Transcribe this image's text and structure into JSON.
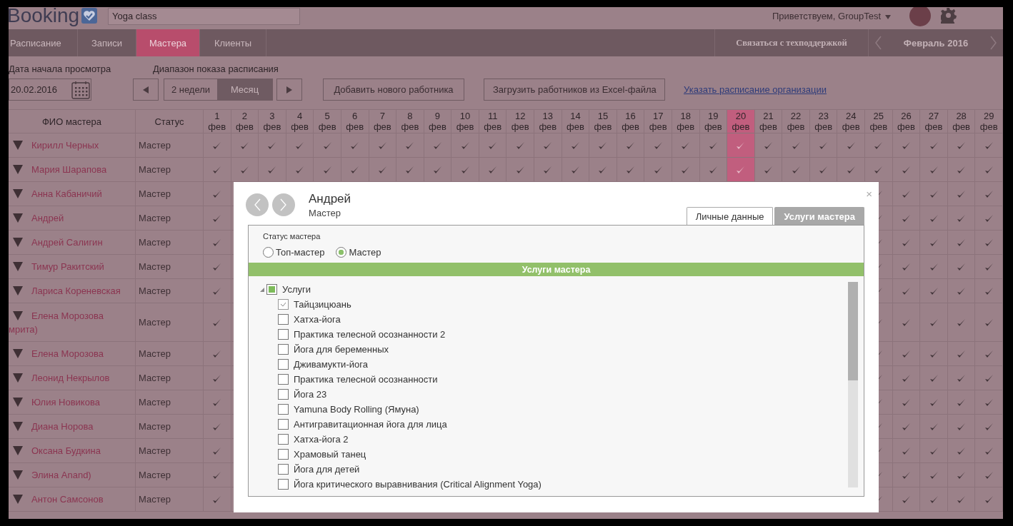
{
  "header": {
    "logo": "Booking",
    "search": {
      "value": "Yoga class"
    },
    "greeting": "Приветствуем, GroupTest"
  },
  "nav": {
    "tabs": [
      {
        "label": "Расписание",
        "selected": false
      },
      {
        "label": "Записи",
        "selected": false
      },
      {
        "label": "Мастера",
        "selected": true
      },
      {
        "label": "Клиенты",
        "selected": false
      }
    ],
    "support": "Связаться с техподдержкой",
    "month": "Февраль 2016"
  },
  "toolbar": {
    "date_label": "Дата начала просмотра",
    "date": {
      "value": "20.02.2016"
    },
    "range_label": "Диапазон показа расписания",
    "range": [
      {
        "label": "2 недели",
        "selected": false
      },
      {
        "label": "Месяц",
        "selected": true
      }
    ],
    "buttons": [
      "Добавить нового работника",
      "Загрузить работников из Excel-файла"
    ],
    "link": "Указать расписание организации"
  },
  "table": {
    "columns": [
      "ФИО мастера",
      "Статус"
    ],
    "days": [
      {
        "number": "1",
        "month": "фев",
        "today": false
      },
      {
        "number": "2",
        "month": "фев",
        "today": false
      },
      {
        "number": "3",
        "month": "фев",
        "today": false
      },
      {
        "number": "4",
        "month": "фев",
        "today": false
      },
      {
        "number": "5",
        "month": "фев",
        "today": false
      },
      {
        "number": "6",
        "month": "фев",
        "today": false
      },
      {
        "number": "7",
        "month": "фев",
        "today": false
      },
      {
        "number": "8",
        "month": "фев",
        "today": false
      },
      {
        "number": "9",
        "month": "фев",
        "today": false
      },
      {
        "number": "10",
        "month": "фев",
        "today": false
      },
      {
        "number": "11",
        "month": "фев",
        "today": false
      },
      {
        "number": "12",
        "month": "фев",
        "today": false
      },
      {
        "number": "13",
        "month": "фев",
        "today": false
      },
      {
        "number": "14",
        "month": "фев",
        "today": false
      },
      {
        "number": "15",
        "month": "фев",
        "today": false
      },
      {
        "number": "16",
        "month": "фев",
        "today": false
      },
      {
        "number": "17",
        "month": "фев",
        "today": false
      },
      {
        "number": "18",
        "month": "фев",
        "today": false
      },
      {
        "number": "19",
        "month": "фев",
        "today": false
      },
      {
        "number": "20",
        "month": "фев",
        "today": true
      },
      {
        "number": "21",
        "month": "фев",
        "today": false
      },
      {
        "number": "22",
        "month": "фев",
        "today": false
      },
      {
        "number": "23",
        "month": "фев",
        "today": false
      },
      {
        "number": "24",
        "month": "фев",
        "today": false
      },
      {
        "number": "25",
        "month": "фев",
        "today": false
      },
      {
        "number": "26",
        "month": "фев",
        "today": false
      },
      {
        "number": "27",
        "month": "фев",
        "today": false
      },
      {
        "number": "28",
        "month": "фев",
        "today": false
      },
      {
        "number": "29",
        "month": "фев",
        "today": false
      }
    ],
    "rows": [
      {
        "name": "Кирилл Черных",
        "status": "Мастер",
        "checks": [
          true,
          true,
          true,
          true,
          true,
          true,
          true,
          true,
          true,
          true,
          true,
          true,
          true,
          true,
          true,
          true,
          true,
          true,
          true,
          true,
          true,
          true,
          true,
          true,
          true,
          true,
          true,
          true,
          true
        ]
      },
      {
        "name": "Мария Шарапова",
        "status": "Мастер",
        "checks": [
          true,
          true,
          true,
          true,
          true,
          true,
          true,
          true,
          true,
          true,
          true,
          true,
          true,
          true,
          true,
          true,
          true,
          true,
          true,
          true,
          true,
          true,
          true,
          true,
          true,
          true,
          true,
          true,
          true
        ]
      },
      {
        "name": "Анна Кабаничий",
        "status": "Мастер",
        "checks_left": [
          true
        ],
        "checks_right": [
          true,
          true,
          true,
          true,
          true
        ]
      },
      {
        "name": "Андрей",
        "status": "Мастер",
        "checks_left": [
          true
        ],
        "checks_right": [
          true,
          true,
          true,
          true,
          true
        ]
      },
      {
        "name": "Андрей Салигин",
        "status": "Мастер",
        "checks_left": [
          true
        ],
        "checks_right": [
          true,
          true,
          true,
          true,
          true
        ]
      },
      {
        "name": "Тимур Ракитский",
        "status": "Мастер",
        "checks_left": [
          true
        ],
        "checks_right": [
          true,
          true,
          true,
          true,
          true
        ]
      },
      {
        "name": "Лариса Кореневская",
        "status": "Мастер",
        "checks_left": [
          true
        ],
        "checks_right": [
          true,
          true,
          true,
          true,
          true
        ]
      },
      {
        "name": "Елена Морозова",
        "name_continued": "мрита)",
        "status": "Мастер",
        "checks_left": [
          true
        ],
        "checks_right": [
          true,
          true,
          true,
          true,
          true
        ]
      },
      {
        "name": "Елена Морозова",
        "status": "Мастер",
        "checks_left": [
          true
        ],
        "checks_right": [
          true,
          true,
          true,
          true,
          true
        ]
      },
      {
        "name": "Леонид Некрылов",
        "status": "Мастер",
        "checks_left": [
          true
        ],
        "checks_right": [
          true,
          true,
          true,
          true,
          true
        ]
      },
      {
        "name": "Юлия Новикова",
        "status": "Мастер",
        "checks_left": [
          true
        ],
        "checks_right": [
          true,
          true,
          true,
          true,
          true
        ]
      },
      {
        "name": "Диана Норова",
        "status": "Мастер",
        "checks_left": [
          true
        ],
        "checks_right": [
          true,
          true,
          true,
          true,
          true
        ]
      },
      {
        "name": "Оксана Будкина",
        "status": "Мастер",
        "checks_left": [
          true
        ],
        "checks_right": [
          true,
          true,
          true,
          true,
          true
        ]
      },
      {
        "name": "Элина Anand)",
        "status": "Мастер",
        "checks_left": [
          true
        ],
        "checks_right": [
          true,
          true,
          true,
          true,
          true
        ]
      },
      {
        "name": "Антон Самсонов",
        "status": "Мастер",
        "checks_left": [
          true
        ],
        "checks_right": [
          true,
          true,
          true,
          true,
          true
        ]
      }
    ]
  },
  "dialog": {
    "title": "Андрей",
    "subtitle": "Мастер",
    "close": "×",
    "tabs": [
      {
        "label": "Личные данные",
        "selected": false
      },
      {
        "label": "Услуги мастера",
        "selected": true
      }
    ],
    "status_label": "Статус мастера",
    "status_options": [
      {
        "label": "Топ-мастер",
        "selected": false
      },
      {
        "label": "Мастер",
        "selected": true
      }
    ],
    "section_title": "Услуги мастера",
    "tree": [
      {
        "label": "Услуги",
        "checked": false,
        "partial": true,
        "expanded": true,
        "children": [
          {
            "label": "Тайцзицюань",
            "checked": true
          },
          {
            "label": "Хатха-йога",
            "checked": false
          },
          {
            "label": "Практика телесной осознанности 2",
            "checked": false
          },
          {
            "label": "Йога для беременных",
            "checked": false
          },
          {
            "label": "Дживамукти-йога",
            "checked": false
          },
          {
            "label": "Практика телесной осознанности",
            "checked": false
          },
          {
            "label": "Йога 23",
            "checked": false
          },
          {
            "label": "Yamuna Body Rolling (Ямуна)",
            "checked": false
          },
          {
            "label": "Антигравитационная йога для лица",
            "checked": false
          },
          {
            "label": "Хатха-йога 2",
            "checked": false
          },
          {
            "label": "Храмовый танец",
            "checked": false
          },
          {
            "label": "Йога для детей",
            "checked": false
          },
          {
            "label": "Йога критического выравнивания (Critical Alignment Yoga)",
            "checked": false
          }
        ]
      }
    ]
  }
}
